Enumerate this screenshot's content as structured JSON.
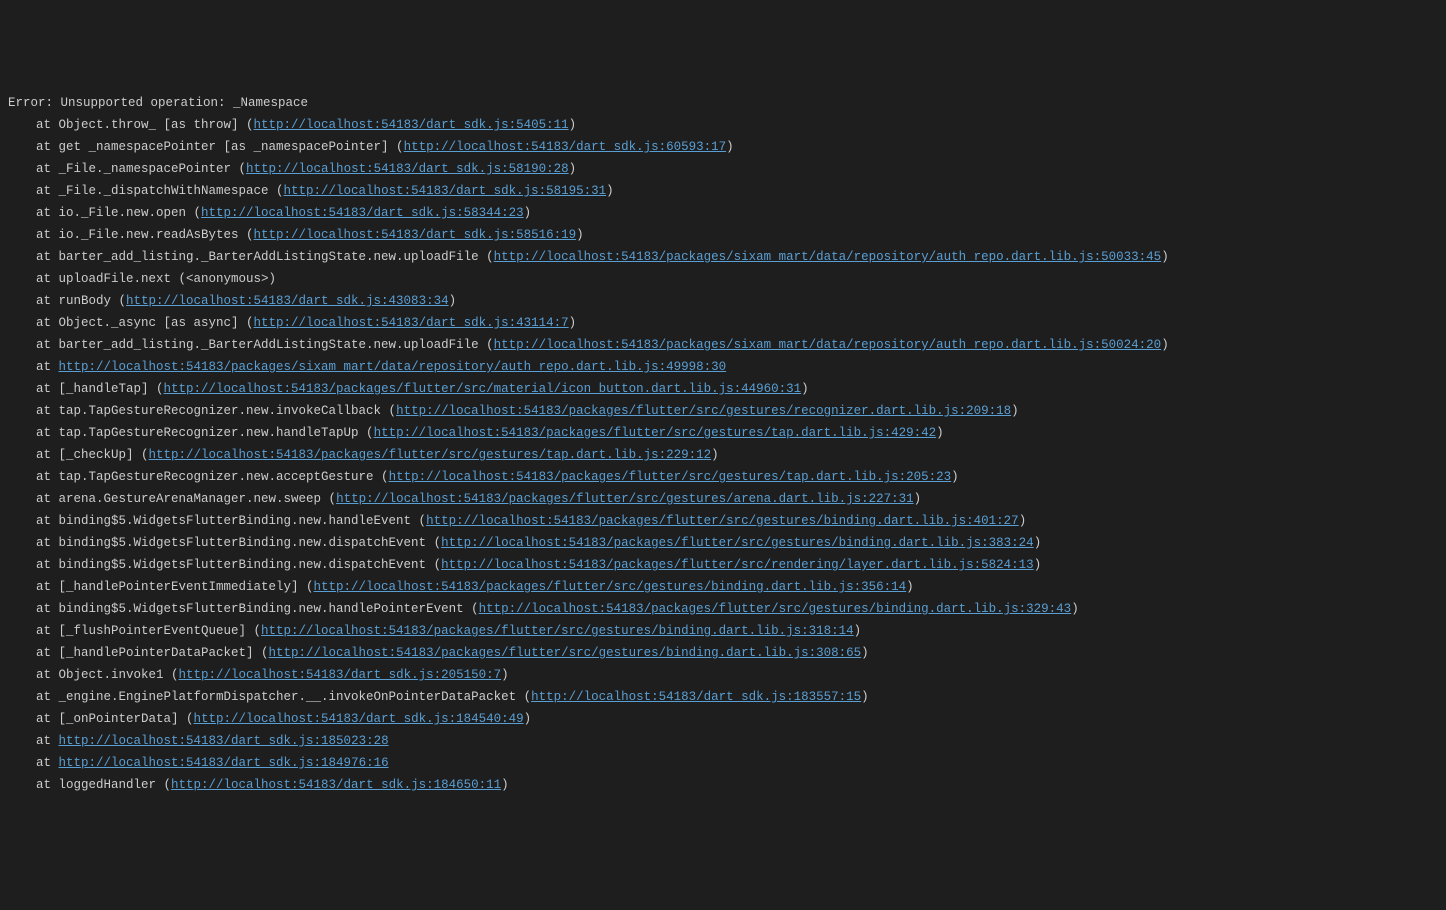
{
  "error_header": "Error: Unsupported operation: _Namespace",
  "stack": [
    {
      "prefix": "at Object.throw_ [as throw] (",
      "link": "http://localhost:54183/dart_sdk.js:5405:11",
      "suffix": ")"
    },
    {
      "prefix": "at get _namespacePointer [as _namespacePointer] (",
      "link": "http://localhost:54183/dart_sdk.js:60593:17",
      "suffix": ")"
    },
    {
      "prefix": "at _File._namespacePointer (",
      "link": "http://localhost:54183/dart_sdk.js:58190:28",
      "suffix": ")"
    },
    {
      "prefix": "at _File._dispatchWithNamespace (",
      "link": "http://localhost:54183/dart_sdk.js:58195:31",
      "suffix": ")"
    },
    {
      "prefix": "at io._File.new.open (",
      "link": "http://localhost:54183/dart_sdk.js:58344:23",
      "suffix": ")"
    },
    {
      "prefix": "at io._File.new.readAsBytes (",
      "link": "http://localhost:54183/dart_sdk.js:58516:19",
      "suffix": ")"
    },
    {
      "prefix": "at barter_add_listing._BarterAddListingState.new.uploadFile (",
      "link": "http://localhost:54183/packages/sixam_mart/data/repository/auth_repo.dart.lib.js:50033:45",
      "suffix": ")"
    },
    {
      "prefix": "at uploadFile.next (<anonymous>)",
      "link": "",
      "suffix": ""
    },
    {
      "prefix": "at runBody (",
      "link": "http://localhost:54183/dart_sdk.js:43083:34",
      "suffix": ")"
    },
    {
      "prefix": "at Object._async [as async] (",
      "link": "http://localhost:54183/dart_sdk.js:43114:7",
      "suffix": ")"
    },
    {
      "prefix": "at barter_add_listing._BarterAddListingState.new.uploadFile (",
      "link": "http://localhost:54183/packages/sixam_mart/data/repository/auth_repo.dart.lib.js:50024:20",
      "suffix": ")"
    },
    {
      "prefix": "at ",
      "link": "http://localhost:54183/packages/sixam_mart/data/repository/auth_repo.dart.lib.js:49998:30",
      "suffix": ""
    },
    {
      "prefix": "at [_handleTap] (",
      "link": "http://localhost:54183/packages/flutter/src/material/icon_button.dart.lib.js:44960:31",
      "suffix": ")"
    },
    {
      "prefix": "at tap.TapGestureRecognizer.new.invokeCallback (",
      "link": "http://localhost:54183/packages/flutter/src/gestures/recognizer.dart.lib.js:209:18",
      "suffix": ")"
    },
    {
      "prefix": "at tap.TapGestureRecognizer.new.handleTapUp (",
      "link": "http://localhost:54183/packages/flutter/src/gestures/tap.dart.lib.js:429:42",
      "suffix": ")"
    },
    {
      "prefix": "at [_checkUp] (",
      "link": "http://localhost:54183/packages/flutter/src/gestures/tap.dart.lib.js:229:12",
      "suffix": ")"
    },
    {
      "prefix": "at tap.TapGestureRecognizer.new.acceptGesture (",
      "link": "http://localhost:54183/packages/flutter/src/gestures/tap.dart.lib.js:205:23",
      "suffix": ")"
    },
    {
      "prefix": "at arena.GestureArenaManager.new.sweep (",
      "link": "http://localhost:54183/packages/flutter/src/gestures/arena.dart.lib.js:227:31",
      "suffix": ")"
    },
    {
      "prefix": "at binding$5.WidgetsFlutterBinding.new.handleEvent (",
      "link": "http://localhost:54183/packages/flutter/src/gestures/binding.dart.lib.js:401:27",
      "suffix": ")"
    },
    {
      "prefix": "at binding$5.WidgetsFlutterBinding.new.dispatchEvent (",
      "link": "http://localhost:54183/packages/flutter/src/gestures/binding.dart.lib.js:383:24",
      "suffix": ")"
    },
    {
      "prefix": "at binding$5.WidgetsFlutterBinding.new.dispatchEvent (",
      "link": "http://localhost:54183/packages/flutter/src/rendering/layer.dart.lib.js:5824:13",
      "suffix": ")"
    },
    {
      "prefix": "at [_handlePointerEventImmediately] (",
      "link": "http://localhost:54183/packages/flutter/src/gestures/binding.dart.lib.js:356:14",
      "suffix": ")"
    },
    {
      "prefix": "at binding$5.WidgetsFlutterBinding.new.handlePointerEvent (",
      "link": "http://localhost:54183/packages/flutter/src/gestures/binding.dart.lib.js:329:43",
      "suffix": ")"
    },
    {
      "prefix": "at [_flushPointerEventQueue] (",
      "link": "http://localhost:54183/packages/flutter/src/gestures/binding.dart.lib.js:318:14",
      "suffix": ")"
    },
    {
      "prefix": "at [_handlePointerDataPacket] (",
      "link": "http://localhost:54183/packages/flutter/src/gestures/binding.dart.lib.js:308:65",
      "suffix": ")"
    },
    {
      "prefix": "at Object.invoke1 (",
      "link": "http://localhost:54183/dart_sdk.js:205150:7",
      "suffix": ")"
    },
    {
      "prefix": "at _engine.EnginePlatformDispatcher.__.invokeOnPointerDataPacket (",
      "link": "http://localhost:54183/dart_sdk.js:183557:15",
      "suffix": ")"
    },
    {
      "prefix": "at [_onPointerData] (",
      "link": "http://localhost:54183/dart_sdk.js:184540:49",
      "suffix": ")"
    },
    {
      "prefix": "at ",
      "link": "http://localhost:54183/dart_sdk.js:185023:28",
      "suffix": ""
    },
    {
      "prefix": "at ",
      "link": "http://localhost:54183/dart_sdk.js:184976:16",
      "suffix": ""
    },
    {
      "prefix": "at loggedHandler (",
      "link": "http://localhost:54183/dart_sdk.js:184650:11",
      "suffix": ")"
    }
  ]
}
